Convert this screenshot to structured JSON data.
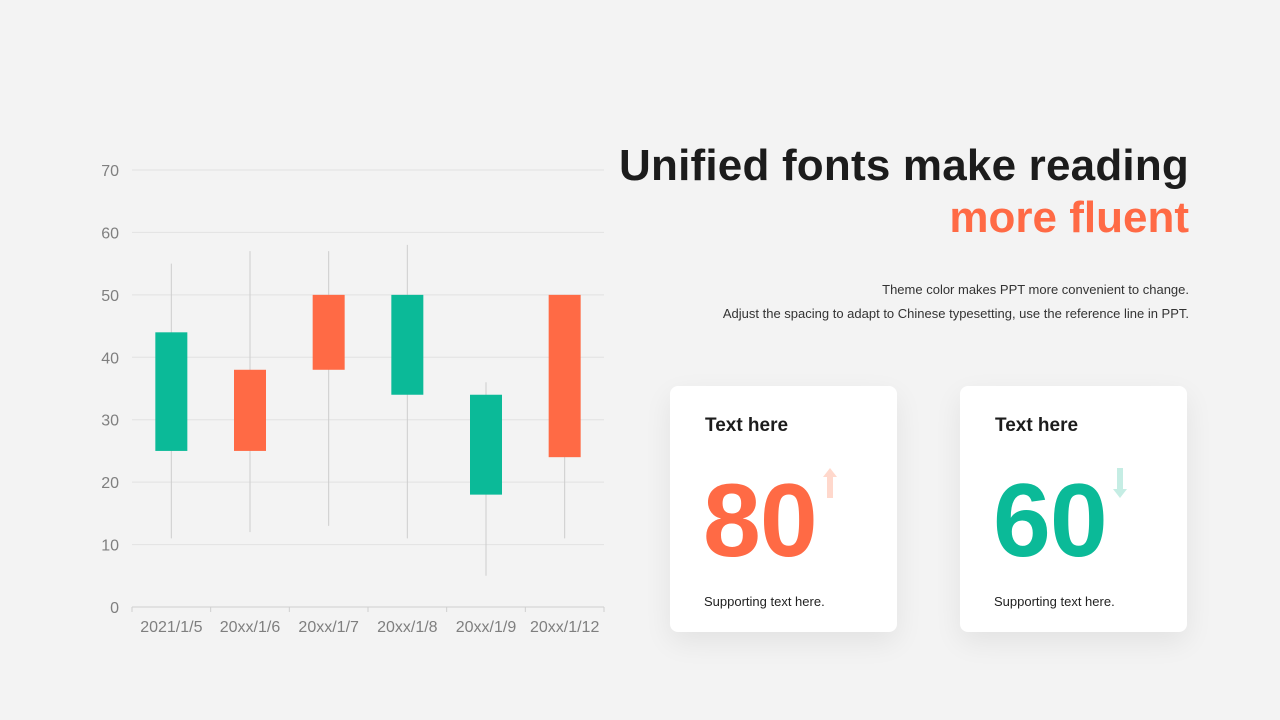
{
  "chart_data": {
    "type": "candlestick",
    "categories": [
      "2021/1/5",
      "20xx/1/6",
      "20xx/1/7",
      "20xx/1/8",
      "20xx/1/9",
      "20xx/1/12"
    ],
    "candles": [
      {
        "open": 25,
        "close": 44,
        "low": 11,
        "high": 55,
        "direction": "up"
      },
      {
        "open": 38,
        "close": 25,
        "low": 12,
        "high": 57,
        "direction": "down"
      },
      {
        "open": 50,
        "close": 38,
        "low": 13,
        "high": 57,
        "direction": "down"
      },
      {
        "open": 34,
        "close": 50,
        "low": 11,
        "high": 58,
        "direction": "up"
      },
      {
        "open": 18,
        "close": 34,
        "low": 5,
        "high": 36,
        "direction": "up"
      },
      {
        "open": 50,
        "close": 24,
        "low": 11,
        "high": 50,
        "direction": "down"
      }
    ],
    "ylim": [
      0,
      70
    ],
    "yticks": [
      0,
      10,
      20,
      30,
      40,
      50,
      60,
      70
    ],
    "grid": true
  },
  "colors": {
    "up": "#0bba98",
    "down": "#ff6a45",
    "accent": "#ff6a45",
    "arrow_up": "#ffd8cc",
    "arrow_down": "#c5ede4"
  },
  "heading": {
    "line1": "Unified fonts make reading",
    "line2": "more fluent"
  },
  "description": {
    "line1": "Theme color makes PPT more convenient to change.",
    "line2": "Adjust the spacing to adapt to Chinese typesetting, use the reference line in PPT."
  },
  "cards": [
    {
      "title": "Text here",
      "value": "80",
      "support": "Supporting text here.",
      "trend": "up",
      "arrow_icon": "arrow-up-icon"
    },
    {
      "title": "Text here",
      "value": "60",
      "support": "Supporting text here.",
      "trend": "down",
      "arrow_icon": "arrow-down-icon"
    }
  ]
}
